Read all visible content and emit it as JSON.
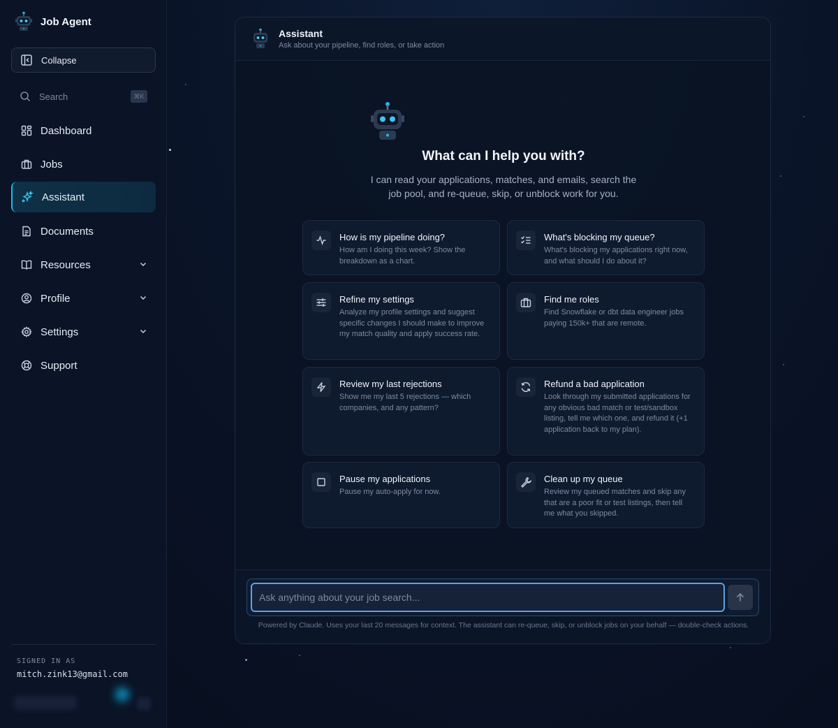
{
  "app": {
    "title": "Job Agent"
  },
  "sidebar": {
    "collapse_label": "Collapse",
    "search_label": "Search",
    "search_shortcut": "⌘K",
    "items": [
      {
        "label": "Dashboard",
        "icon": "dashboard-icon"
      },
      {
        "label": "Jobs",
        "icon": "briefcase-icon"
      },
      {
        "label": "Assistant",
        "icon": "sparkles-icon",
        "active": true
      },
      {
        "label": "Documents",
        "icon": "document-icon"
      },
      {
        "label": "Resources",
        "icon": "book-icon",
        "expandable": true
      },
      {
        "label": "Profile",
        "icon": "user-circle-icon",
        "expandable": true
      },
      {
        "label": "Settings",
        "icon": "gear-icon",
        "expandable": true
      },
      {
        "label": "Support",
        "icon": "lifebuoy-icon"
      }
    ],
    "signed_in_label": "SIGNED IN AS",
    "signed_in_email": "mitch.zink13@gmail.com"
  },
  "assistant": {
    "title": "Assistant",
    "subtitle": "Ask about your pipeline, find roles, or take action",
    "hero_title": "What can I help you with?",
    "hero_text": "I can read your applications, matches, and emails, search the job pool, and re-queue, skip, or unblock work for you.",
    "suggestions": [
      {
        "title": "How is my pipeline doing?",
        "desc": "How am I doing this week? Show the breakdown as a chart.",
        "icon": "activity-icon"
      },
      {
        "title": "What's blocking my queue?",
        "desc": "What's blocking my applications right now, and what should I do about it?",
        "icon": "list-checks-icon"
      },
      {
        "title": "Refine my settings",
        "desc": "Analyze my profile settings and suggest specific changes I should make to improve my match quality and apply success rate.",
        "icon": "sliders-icon"
      },
      {
        "title": "Find me roles",
        "desc": "Find Snowflake or dbt data engineer jobs paying 150k+ that are remote.",
        "icon": "briefcase-icon"
      },
      {
        "title": "Review my last rejections",
        "desc": "Show me my last 5 rejections — which companies, and any pattern?",
        "icon": "bolt-icon"
      },
      {
        "title": "Refund a bad application",
        "desc": "Look through my submitted applications for any obvious bad match or test/sandbox listing, tell me which one, and refund it (+1 application back to my plan).",
        "icon": "refresh-icon"
      },
      {
        "title": "Pause my applications",
        "desc": "Pause my auto-apply for now.",
        "icon": "stop-icon"
      },
      {
        "title": "Clean up my queue",
        "desc": "Review my queued matches and skip any that are a poor fit or test listings, then tell me what you skipped.",
        "icon": "wrench-icon"
      }
    ],
    "input_placeholder": "Ask anything about your job search...",
    "footer_note": "Powered by Claude. Uses your last 20 messages for context. The assistant can re-queue, skip, or unblock jobs on your behalf — double-check actions."
  },
  "colors": {
    "accent": "#22b8e8",
    "active_bg": "#0f3046",
    "focus_ring": "#5aa4e6"
  }
}
